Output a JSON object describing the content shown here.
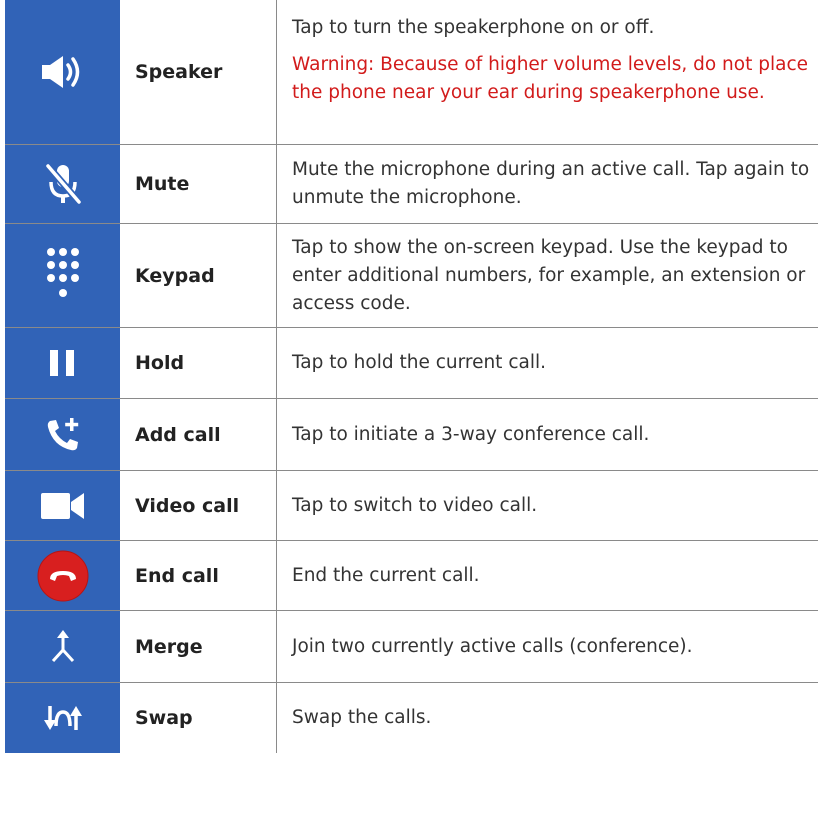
{
  "rows": [
    {
      "icon": "speaker-icon",
      "name": "Speaker",
      "description": "Tap to turn the speakerphone on or off.",
      "warning": "Warning: Because of higher volume levels, do not place the phone near your ear during speakerphone use."
    },
    {
      "icon": "mute-microphone-icon",
      "name": "Mute",
      "description": "Mute the microphone during an active call. Tap again to unmute the microphone."
    },
    {
      "icon": "keypad-icon",
      "name": "Keypad",
      "description": "Tap to show the on-screen keypad. Use the keypad to enter additional numbers, for example, an extension or access code."
    },
    {
      "icon": "pause-icon",
      "name": "Hold",
      "description": "Tap to hold the current call."
    },
    {
      "icon": "add-call-icon",
      "name": "Add call",
      "description": "Tap to initiate a 3-way conference call."
    },
    {
      "icon": "video-camera-icon",
      "name": "Video call",
      "description": "Tap to switch to video call."
    },
    {
      "icon": "end-call-icon",
      "name": "End call",
      "description": "End the current call."
    },
    {
      "icon": "merge-icon",
      "name": "Merge",
      "description": "Join two currently active calls (conference)."
    },
    {
      "icon": "swap-icon",
      "name": "Swap",
      "description": "Swap the calls."
    }
  ],
  "colors": {
    "icon_column_background": "#3163b7",
    "warning_text": "#d21b1b",
    "end_call_button": "#d81f1f"
  }
}
